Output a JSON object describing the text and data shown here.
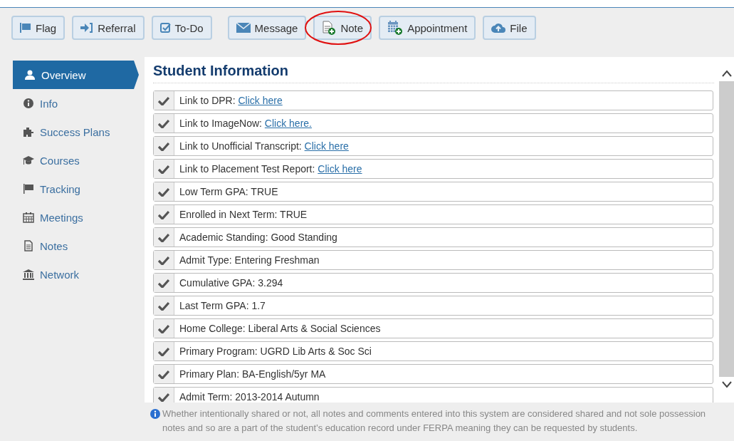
{
  "toolbar_left": [
    {
      "label": "Flag"
    },
    {
      "label": "Referral"
    },
    {
      "label": "To-Do"
    }
  ],
  "toolbar_right": [
    {
      "label": "Message",
      "highlighted": false
    },
    {
      "label": "Note",
      "highlighted": true
    },
    {
      "label": "Appointment",
      "highlighted": false
    },
    {
      "label": "File",
      "highlighted": false
    }
  ],
  "sidebar": {
    "items": [
      {
        "label": "Overview",
        "selected": true
      },
      {
        "label": "Info",
        "selected": false
      },
      {
        "label": "Success Plans",
        "selected": false
      },
      {
        "label": "Courses",
        "selected": false
      },
      {
        "label": "Tracking",
        "selected": false
      },
      {
        "label": "Meetings",
        "selected": false
      },
      {
        "label": "Notes",
        "selected": false
      },
      {
        "label": "Network",
        "selected": false
      }
    ]
  },
  "panel": {
    "title": "Student Information",
    "rows": [
      {
        "text": "Link to DPR: ",
        "link": "Click here"
      },
      {
        "text": "Link to ImageNow: ",
        "link": "Click here."
      },
      {
        "text": "Link to Unofficial Transcript: ",
        "link": "Click here"
      },
      {
        "text": "Link to Placement Test Report: ",
        "link": "Click here"
      },
      {
        "text": "Low Term GPA: TRUE"
      },
      {
        "text": "Enrolled in Next Term: TRUE"
      },
      {
        "text": "Academic Standing: Good Standing"
      },
      {
        "text": "Admit Type: Entering Freshman"
      },
      {
        "text": "Cumulative GPA: 3.294"
      },
      {
        "text": "Last Term GPA: 1.7"
      },
      {
        "text": "Home College: Liberal Arts & Social Sciences"
      },
      {
        "text": "Primary Program: UGRD Lib Arts & Soc Sci"
      },
      {
        "text": "Primary Plan: BA-English/5yr MA"
      },
      {
        "text": "Admit Term: 2013-2014 Autumn"
      }
    ]
  },
  "footer_note": "Whether intentionally shared or not, all notes and comments entered into this system are considered shared and not sole possession notes and so are a part of the student’s education record under FERPA meaning they can be requested by students."
}
